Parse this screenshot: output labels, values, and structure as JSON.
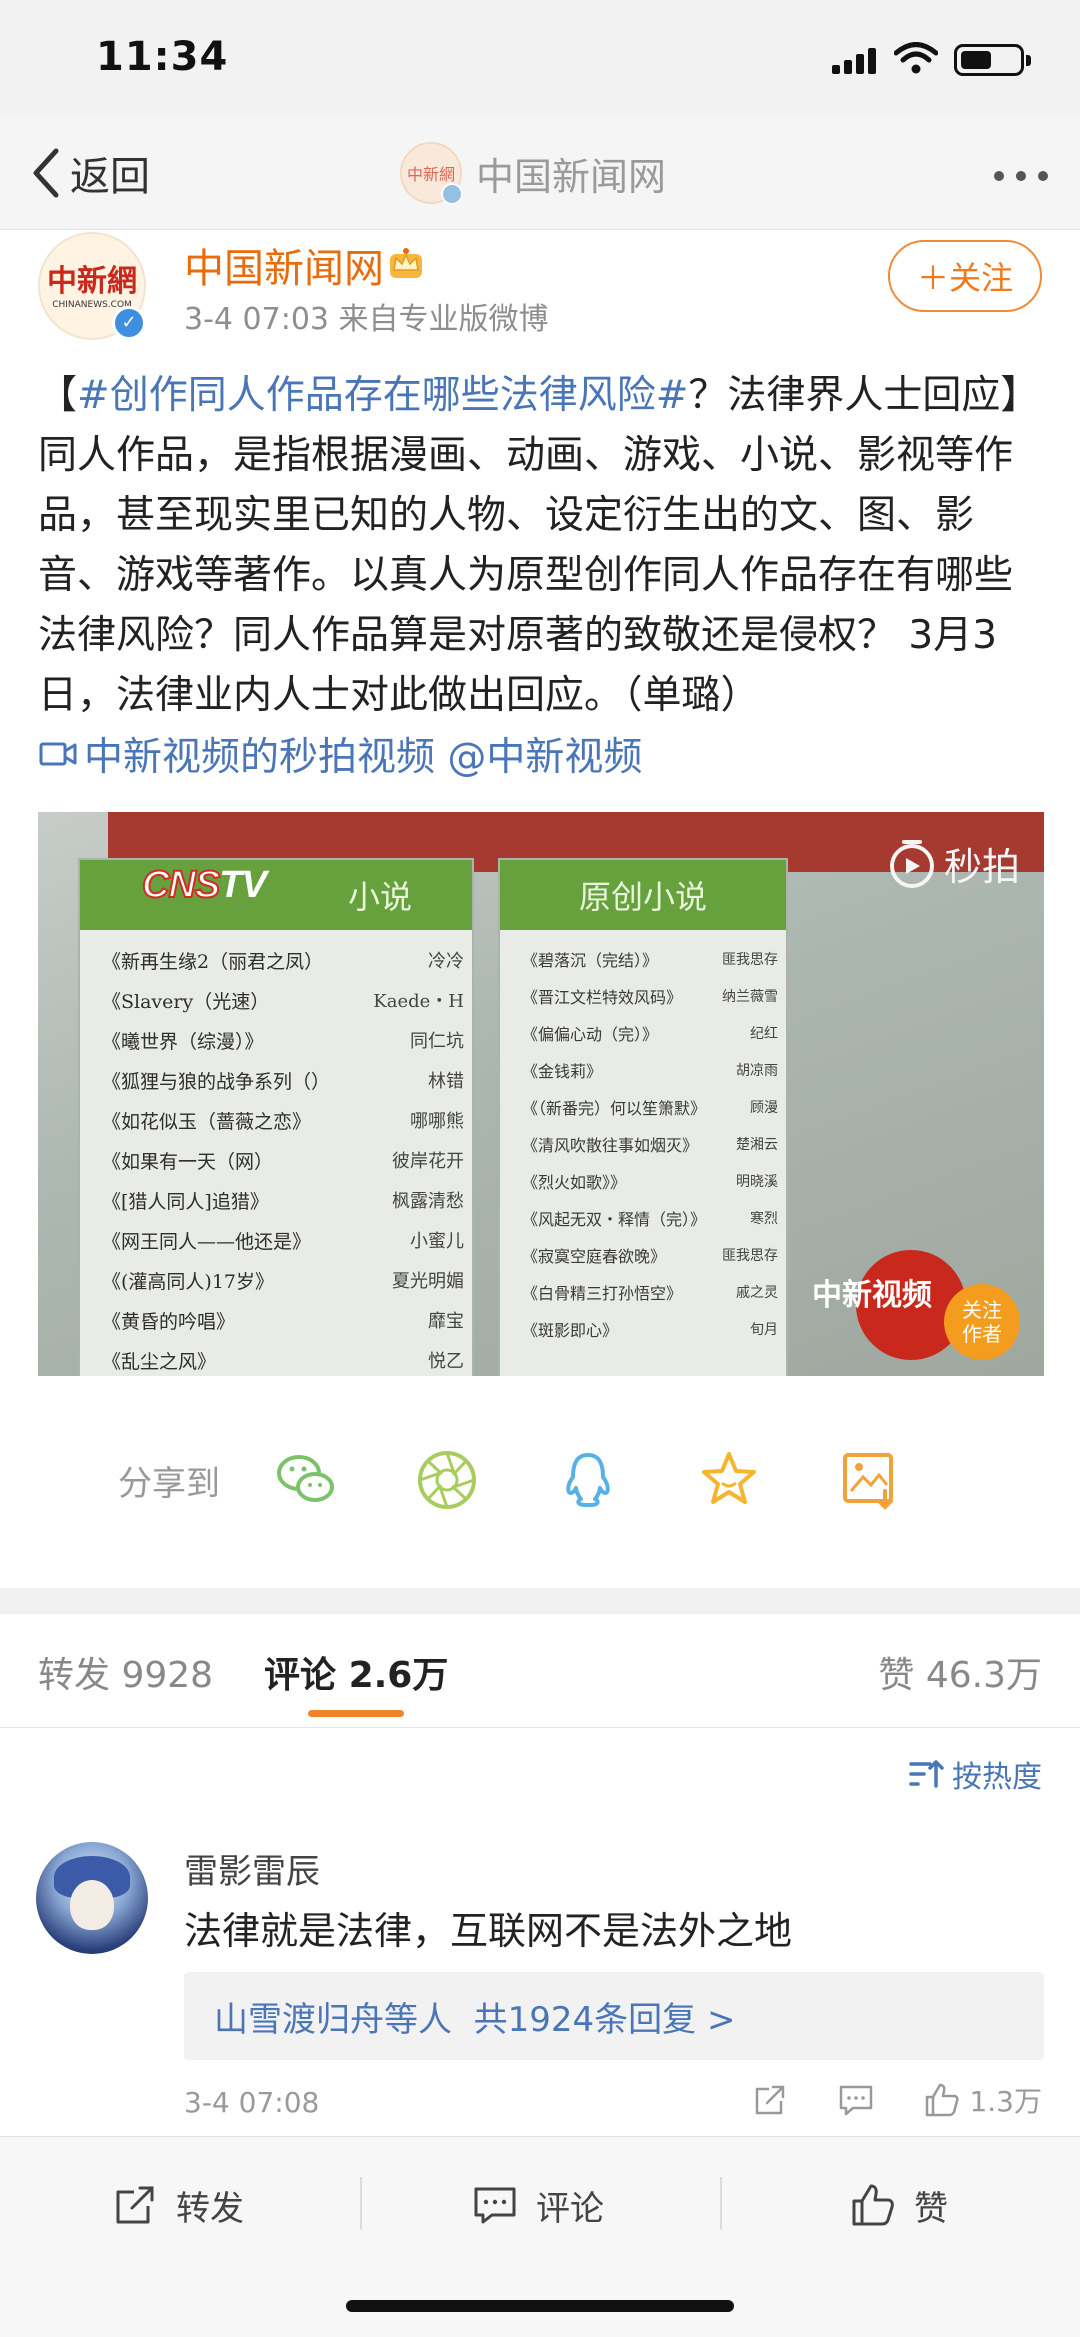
{
  "status_bar": {
    "time": "11:34"
  },
  "nav": {
    "back_label": "返回",
    "title": "中国新闻网",
    "logo_text": "中新網"
  },
  "author": {
    "name": "中国新闻网",
    "meta": "3-4 07:03  来自专业版微博",
    "avatar_logo": "中新網",
    "avatar_sub": "CHINANEWS.COM",
    "follow_label": "＋关注"
  },
  "post": {
    "open_bracket": "【",
    "hashtag": "#创作同人作品存在哪些法律风险#",
    "body": "？法律界人士回应】同人作品，是指根据漫画、动画、游戏、小说、影视等作品，甚至现实里已知的人物、设定衍生出的文、图、影音、游戏等著作。以真人为原型创作同人作品存在有哪些法律风险？同人作品算是对原著的致敬还是侵权？ 3月3日，法律业内人士对此做出回应。（单璐）",
    "video_link": "中新视频的秒拍视频 @中新视频"
  },
  "video": {
    "watermark": "秒拍",
    "channel_logo_cns": "CNS",
    "channel_logo_tv": "TV",
    "badge_text": "中新视频",
    "follow_author": "关注\n作者",
    "left_panel_title": "小说",
    "right_panel_title": "原创小说",
    "left_rows": [
      {
        "title": "《新再生缘2（丽君之凤）",
        "who": "冷冷"
      },
      {
        "title": "《Slavery（光速）",
        "who": "Kaede・H"
      },
      {
        "title": "《曦世界（综漫）》",
        "who": "同仁坑"
      },
      {
        "title": "《狐狸与狼的战争系列（）",
        "who": "林错"
      },
      {
        "title": "《如花似玉（蔷薇之恋》",
        "who": "哪哪熊"
      },
      {
        "title": "《如果有一天（网）",
        "who": "彼岸花开"
      },
      {
        "title": "《[猎人同人]追猎》",
        "who": "枫露清愁"
      },
      {
        "title": "《网王同人——他还是》",
        "who": "小蜜儿"
      },
      {
        "title": "《(灌高同人)17岁》",
        "who": "夏光明媚"
      },
      {
        "title": "《黄昏的吟唱》",
        "who": "靡宝"
      },
      {
        "title": "《乱尘之风》",
        "who": "悦乙"
      }
    ],
    "right_rows": [
      {
        "title": "《碧落沉（完结）》",
        "who": "匪我思存"
      },
      {
        "title": "《晋江文栏特效风码》",
        "who": "纳兰薇雪"
      },
      {
        "title": "《偏偏心动（完）》",
        "who": "纪红"
      },
      {
        "title": "《金钱莉》",
        "who": "胡凉雨"
      },
      {
        "title": "《（新番完）何以笙箫默》",
        "who": "顾漫"
      },
      {
        "title": "《清风吹散往事如烟灭》",
        "who": "楚湘云"
      },
      {
        "title": "《烈火如歌》》",
        "who": "明晓溪"
      },
      {
        "title": "《风起无双・释情（完）》",
        "who": "寒烈"
      },
      {
        "title": "《寂寞空庭春欲晚》",
        "who": "匪我思存"
      },
      {
        "title": "《白骨精三打孙悟空》",
        "who": "戚之灵"
      },
      {
        "title": "《斑影即心》",
        "who": "旬月"
      }
    ]
  },
  "share": {
    "label": "分享到",
    "targets": [
      "wechat-icon",
      "moments-icon",
      "qq-icon",
      "favorite-icon",
      "save-image-icon"
    ]
  },
  "tabs": {
    "repost": "转发 9928",
    "comment_label": "评论",
    "comment_count": "2.6万",
    "likes": "赞 46.3万"
  },
  "sort_label": "按热度",
  "comment": {
    "user": "雷影雷辰",
    "text": "法律就是法律，互联网不是法外之地",
    "replies_prefix": "山雪渡归舟等人",
    "replies_count": "共1924条回复 >",
    "time": "3-4 07:08",
    "likes": "1.3万"
  },
  "bottom_bar": {
    "repost": "转发",
    "comment": "评论",
    "like": "赞"
  },
  "colors": {
    "accent_orange": "#f07a1c",
    "link_blue": "#4a76b8",
    "name_orange": "#e86b0c"
  }
}
